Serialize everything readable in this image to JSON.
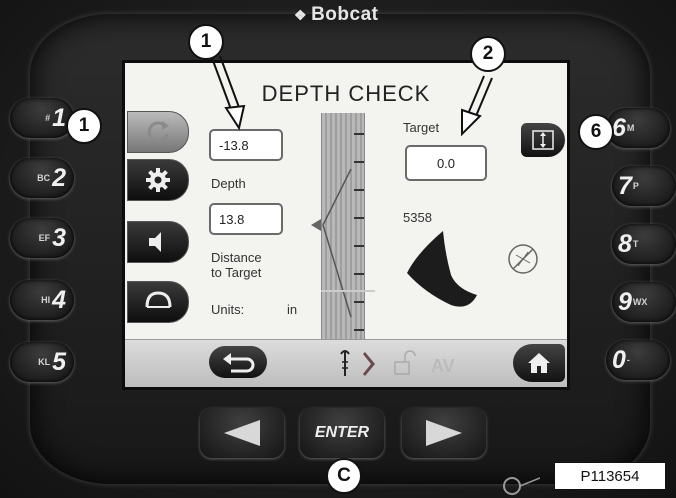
{
  "brand": {
    "name": "Bobcat"
  },
  "screen": {
    "title": "DEPTH CHECK",
    "depth": {
      "value": "-13.8",
      "label": "Depth"
    },
    "distance": {
      "value": "13.8",
      "label_line1": "Distance",
      "label_line2": "to Target"
    },
    "units": {
      "label": "Units:",
      "value": "in"
    },
    "target": {
      "label": "Target",
      "value": "0.0"
    },
    "reading": "5358"
  },
  "keypad_left": [
    {
      "sub": "#",
      "num": "1"
    },
    {
      "sub": "BC",
      "num": "2"
    },
    {
      "sub": "EF",
      "num": "3"
    },
    {
      "sub": "HI",
      "num": "4"
    },
    {
      "sub": "KL",
      "num": "5"
    }
  ],
  "keypad_right": [
    {
      "num": "6",
      "sub": "M"
    },
    {
      "num": "7",
      "sub": "P"
    },
    {
      "num": "8",
      "sub": "T"
    },
    {
      "num": "9",
      "sub": "WX"
    },
    {
      "num": "0",
      "sub": "-"
    }
  ],
  "nav": {
    "enter_label": "ENTER"
  },
  "callouts": [
    "1",
    "1",
    "2",
    "6",
    "C"
  ],
  "figure_id": "P113654",
  "colors": {
    "screen_bg": "#f3f3f0",
    "panel": "#1e1e1e",
    "callout_bg": "#ffffff"
  }
}
